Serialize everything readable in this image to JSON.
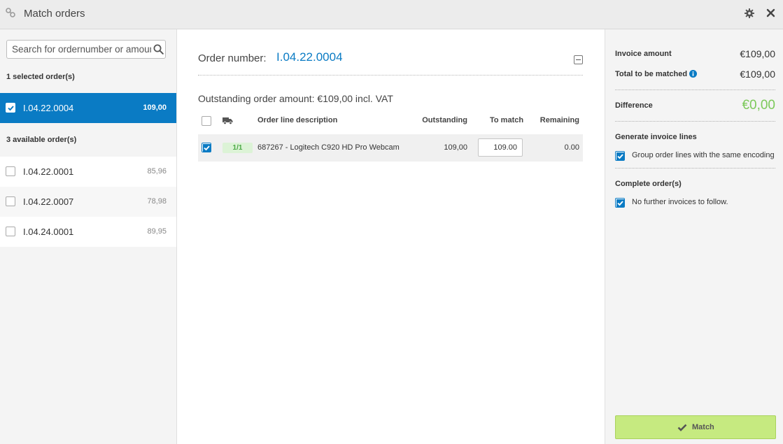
{
  "window": {
    "title": "Match orders",
    "icons": [
      "link-icon",
      "gear-icon",
      "close-icon"
    ]
  },
  "left": {
    "search_placeholder": "Search for ordernumber or amount",
    "selected_label": "1 selected order(s)",
    "selected_orders": [
      {
        "number": "I.04.22.0004",
        "amount": "109,00",
        "checked": true
      }
    ],
    "available_label": "3 available order(s)",
    "available_orders": [
      {
        "number": "I.04.22.0001",
        "amount": "85,96",
        "checked": false
      },
      {
        "number": "I.04.22.0007",
        "amount": "78,98",
        "checked": false
      },
      {
        "number": "I.04.24.0001",
        "amount": "89,95",
        "checked": false
      }
    ]
  },
  "middle": {
    "order_number_label": "Order number:",
    "order_number": "I.04.22.0004",
    "outstanding_text": "Outstanding order amount: €109,00 incl. VAT",
    "columns": {
      "description": "Order line description",
      "outstanding": "Outstanding",
      "to_match": "To match",
      "remaining": "Remaining"
    },
    "lines": [
      {
        "checked": true,
        "badge": "1/1",
        "description": "687267 - Logitech C920 HD Pro Webcam",
        "outstanding": "109,00",
        "to_match": "109.00",
        "remaining": "0.00"
      }
    ]
  },
  "right": {
    "invoice_amount_label": "Invoice amount",
    "invoice_amount": "€109,00",
    "total_label": "Total to be matched",
    "total": "€109,00",
    "difference_label": "Difference",
    "difference": "€0,00",
    "generate_label": "Generate invoice lines",
    "group_option": "Group order lines with the same encoding",
    "complete_label": "Complete order(s)",
    "no_further_option": "No further invoices to follow.",
    "match_button": "Match"
  },
  "colors": {
    "accent": "#0a7bc4",
    "success": "#7cc95a",
    "match_button": "#c6ea80",
    "badge_bg": "#dcf3d6"
  }
}
